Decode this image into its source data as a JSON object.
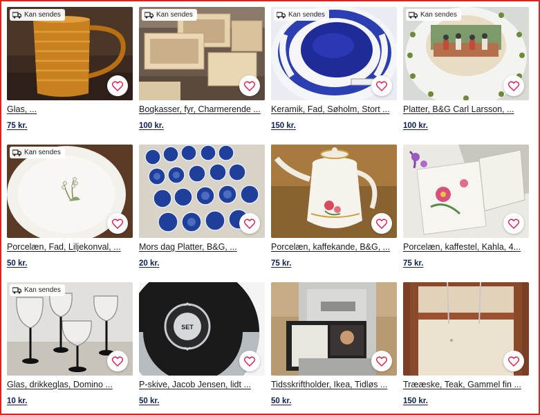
{
  "badge_label": "Kan sendes",
  "items": [
    {
      "title": "Glas, ...",
      "price": "75 kr.",
      "ships": true
    },
    {
      "title": "Bogkasser, fyr, Charmerende ...",
      "price": "100 kr.",
      "ships": true
    },
    {
      "title": "Keramik, Fad, Søholm, Stort ...",
      "price": "150 kr.",
      "ships": true
    },
    {
      "title": "Platter, B&G Carl Larsson, ...",
      "price": "100 kr.",
      "ships": true
    },
    {
      "title": "Porcelæn, Fad, Liljekonval, ...",
      "price": "50 kr.",
      "ships": true
    },
    {
      "title": "Mors dag Platter, B&G, ...",
      "price": "20 kr.",
      "ships": false
    },
    {
      "title": "Porcelæn, kaffekande, B&G, ...",
      "price": "75 kr.",
      "ships": false
    },
    {
      "title": "Porcelæn, kaffestel, Kahla, 4...",
      "price": "75 kr.",
      "ships": false
    },
    {
      "title": "Glas, drikkeglas, Domino ...",
      "price": "10 kr.",
      "ships": true
    },
    {
      "title": "P-skive, Jacob Jensen, lidt ...",
      "price": "50 kr.",
      "ships": false
    },
    {
      "title": "Tidsskriftholder, Ikea, Tidløs ...",
      "price": "50 kr.",
      "ships": false
    },
    {
      "title": "Trææske, Teak, Gammel fin ...",
      "price": "150 kr.",
      "ships": false
    }
  ],
  "dial_label": "SET",
  "colors": {
    "price": "#0c1f4e",
    "frame": "#d9261c",
    "heart": "#d81b4a"
  }
}
